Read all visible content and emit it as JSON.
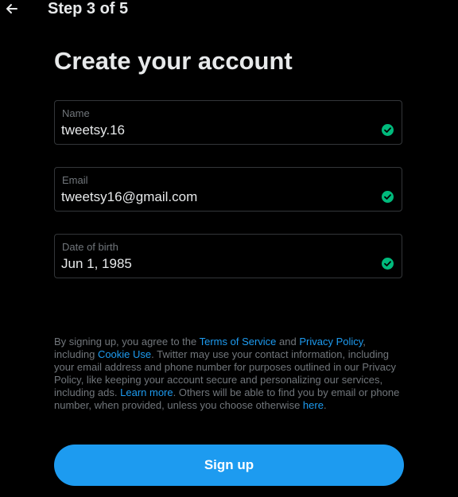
{
  "header": {
    "back_icon": "arrow-left-icon",
    "step_label": "Step 3 of 5"
  },
  "title": "Create your account",
  "fields": [
    {
      "label": "Name",
      "value": "tweetsy.16",
      "valid": true,
      "status_icon": "check-circle-icon"
    },
    {
      "label": "Email",
      "value": "tweetsy16@gmail.com",
      "valid": true,
      "status_icon": "check-circle-icon"
    },
    {
      "label": "Date of birth",
      "value": "Jun 1, 1985",
      "valid": true,
      "status_icon": "check-circle-icon"
    }
  ],
  "legal": {
    "t1": "By signing up, you agree to the ",
    "terms_link": "Terms of Service",
    "t2": " and ",
    "privacy_link": "Privacy Policy",
    "t3": ", including ",
    "cookie_link": "Cookie Use",
    "t4": ". Twitter may use your contact information, including your email address and phone number for purposes outlined in our Privacy Policy, like keeping your account secure and personalizing our services, including ads. ",
    "learn_more_link": "Learn more",
    "t5": ". Others will be able to find you by email or phone number, when provided, unless you choose otherwise ",
    "here_link": "here",
    "t6": "."
  },
  "signup_button": "Sign up",
  "colors": {
    "background": "#000000",
    "text_primary": "#e7e9ea",
    "text_secondary": "#71767b",
    "accent": "#1d9bf0",
    "success": "#00ba7c",
    "border": "#333639"
  }
}
